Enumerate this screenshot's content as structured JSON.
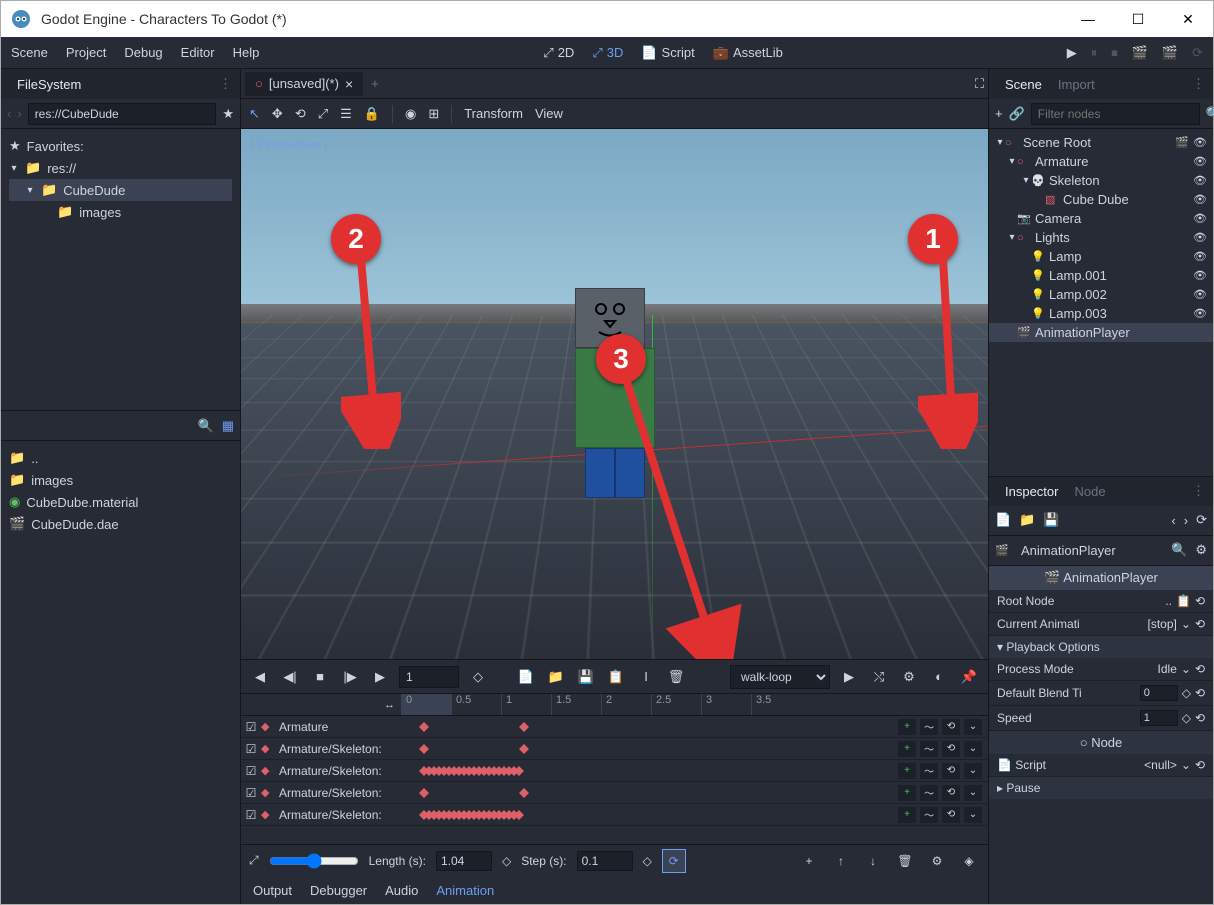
{
  "titlebar": {
    "text": "Godot Engine - Characters To Godot (*)"
  },
  "menu": {
    "scene": "Scene",
    "project": "Project",
    "debug": "Debug",
    "editor": "Editor",
    "help": "Help",
    "ws2d": "2D",
    "ws3d": "3D",
    "script": "Script",
    "assetlib": "AssetLib"
  },
  "filesystem": {
    "title": "FileSystem",
    "path": "res://CubeDude",
    "favorites": "Favorites:",
    "tree": {
      "root": "res://",
      "cubedude": "CubeDude",
      "images": "images"
    },
    "files": {
      "dotdot": "..",
      "images": "images",
      "material": "CubeDube.material",
      "dae": "CubeDude.dae"
    }
  },
  "viewport": {
    "tab": "[unsaved](*)",
    "perspective": "[ Perspective ]",
    "transform": "Transform",
    "view": "View"
  },
  "callouts": {
    "c1": "1",
    "c2": "2",
    "c3": "3"
  },
  "animation": {
    "frame": "1",
    "select": "walk-loop",
    "ticks": [
      "0",
      "0.5",
      "1",
      "1.5",
      "2",
      "2.5",
      "3",
      "3.5"
    ],
    "tracks": [
      "Armature",
      "Armature/Skeleton:",
      "Armature/Skeleton:",
      "Armature/Skeleton:",
      "Armature/Skeleton:"
    ],
    "length_label": "Length (s):",
    "length": "1.04",
    "step_label": "Step (s):",
    "step": "0.1"
  },
  "bottom_tabs": {
    "output": "Output",
    "debugger": "Debugger",
    "audio": "Audio",
    "animation": "Animation"
  },
  "scene": {
    "tab": "Scene",
    "import_tab": "Import",
    "filter_placeholder": "Filter nodes",
    "nodes": {
      "root": "Scene Root",
      "armature": "Armature",
      "skeleton": "Skeleton",
      "cubedube": "Cube Dube",
      "camera": "Camera",
      "lights": "Lights",
      "lamp": "Lamp",
      "lamp1": "Lamp.001",
      "lamp2": "Lamp.002",
      "lamp3": "Lamp.003",
      "animplayer": "AnimationPlayer"
    }
  },
  "inspector": {
    "tab": "Inspector",
    "node_tab": "Node",
    "title": "AnimationPlayer",
    "class_title": "AnimationPlayer",
    "root_node": "Root Node",
    "root_node_val": "..",
    "current_anim": "Current Animati",
    "current_anim_val": "[stop]",
    "playback": "Playback Options",
    "process_mode": "Process Mode",
    "process_mode_val": "Idle",
    "blend": "Default Blend Ti",
    "blend_val": "0",
    "speed": "Speed",
    "speed_val": "1",
    "node_section": "Node",
    "script": "Script",
    "script_val": "<null>",
    "pause": "Pause"
  }
}
